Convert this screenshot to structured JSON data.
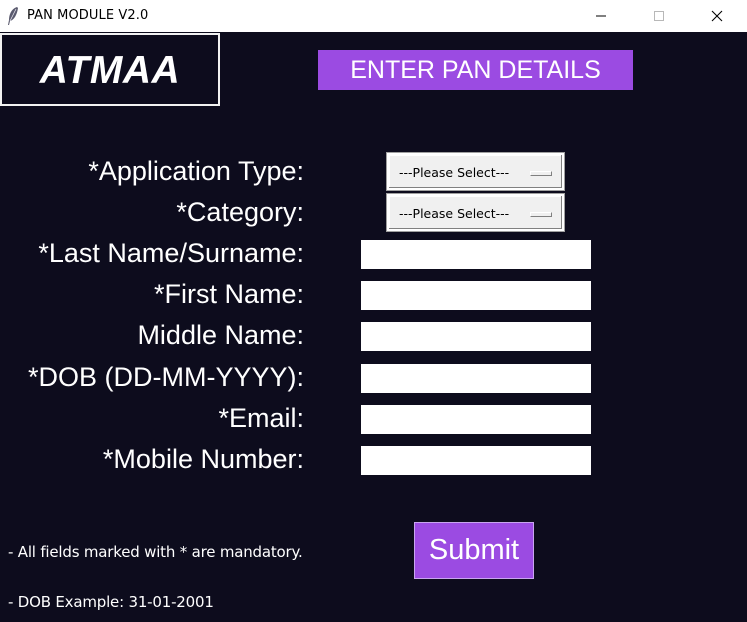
{
  "window": {
    "title": "PAN MODULE V2.0",
    "icon": "feather-icon"
  },
  "logo": {
    "text": "ATMAA"
  },
  "header": {
    "label": "ENTER PAN DETAILS"
  },
  "form": {
    "application_type": {
      "label": "*Application Type:",
      "selected": "---Please Select---"
    },
    "category": {
      "label": "*Category:",
      "selected": "---Please Select---"
    },
    "last_name": {
      "label": "*Last Name/Surname:",
      "value": ""
    },
    "first_name": {
      "label": "*First Name:",
      "value": ""
    },
    "middle_name": {
      "label": "Middle Name:",
      "value": ""
    },
    "dob": {
      "label": "*DOB (DD-MM-YYYY):",
      "value": ""
    },
    "email": {
      "label": "*Email:",
      "value": ""
    },
    "mobile": {
      "label": "*Mobile Number:",
      "value": ""
    }
  },
  "submit": {
    "label": "Submit"
  },
  "notes": {
    "mandatory": "- All fields marked with * are mandatory.",
    "dob_example": "- DOB Example: 31-01-2001"
  },
  "colors": {
    "background": "#0d0c1d",
    "accent": "#9b4be2",
    "text": "#ffffff"
  }
}
